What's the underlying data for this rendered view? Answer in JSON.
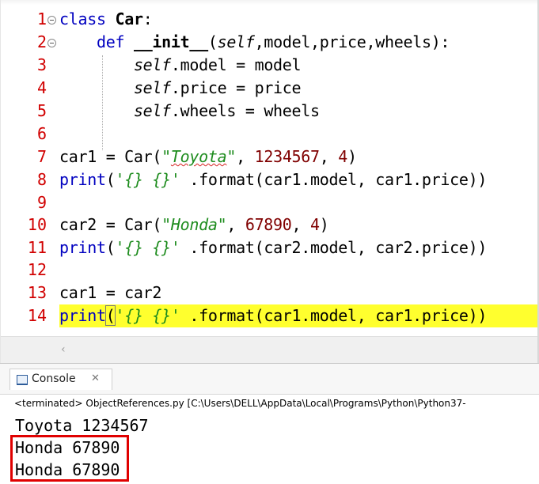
{
  "editor": {
    "lines": [
      {
        "num": "1"
      },
      {
        "num": "2"
      },
      {
        "num": "3"
      },
      {
        "num": "4"
      },
      {
        "num": "5"
      },
      {
        "num": "6"
      },
      {
        "num": "7"
      },
      {
        "num": "8"
      },
      {
        "num": "9"
      },
      {
        "num": "10"
      },
      {
        "num": "11"
      },
      {
        "num": "12"
      },
      {
        "num": "13"
      },
      {
        "num": "14"
      }
    ],
    "t": {
      "class_kw": "class",
      "class_name": "Car",
      "colon": ":",
      "def_kw": "def",
      "init_name": "__init__",
      "init_open": "(",
      "self": "self",
      "init_params": ",model,price,wheels):",
      "attr_model": ".model = model",
      "attr_price": ".price = price",
      "attr_wheels": ".wheels = wheels",
      "car1_assign": "car1 = Car(",
      "str_toyota_q1": "\"",
      "str_toyota_word": "Toyota",
      "str_toyota_q2": "\"",
      "sep": ", ",
      "num_1234567": "1234567",
      "num_4": "4",
      "close_paren": ")",
      "print_kw": "print",
      "print_open": "(",
      "fmt_str": "'{} {}'",
      "format_car1": " .format(car1.model, car1.price))",
      "car2_assign": "car2 = Car(",
      "str_honda": "\"Honda\"",
      "num_67890": "67890",
      "format_car2": " .format(car2.model, car2.price))",
      "car1_eq_car2": "car1 = car2"
    },
    "scroll_arrow": "‹"
  },
  "console": {
    "tab_label": "Console",
    "tab_close": "✕",
    "status": "<terminated> ObjectReferences.py [C:\\Users\\DELL\\AppData\\Local\\Programs\\Python\\Python37-",
    "output": [
      "Toyota 1234567",
      "Honda 67890",
      "Honda 67890"
    ]
  },
  "colors": {
    "line_number": "#d10000",
    "keyword": "#0000c0",
    "string": "#1e8c1e",
    "number": "#800000",
    "current_line_highlight": "#ffff2e",
    "annotation_box": "#e00000"
  }
}
